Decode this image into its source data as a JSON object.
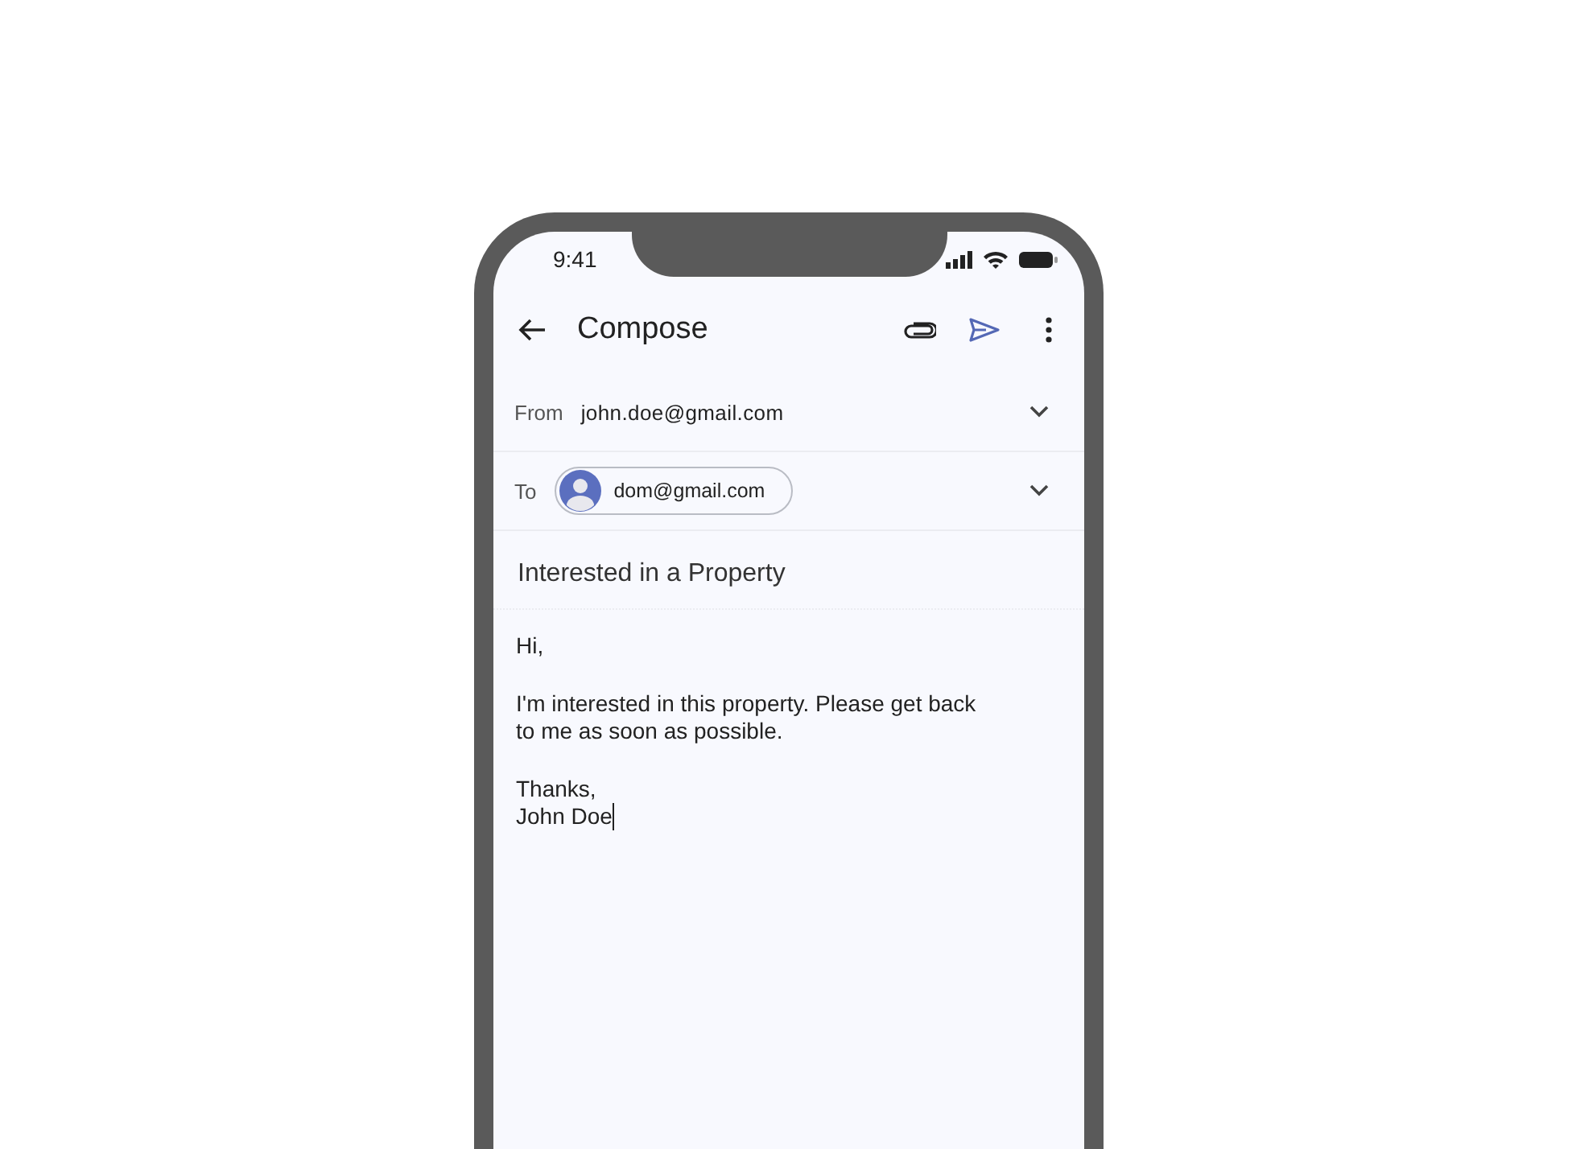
{
  "status_bar": {
    "time": "9:41"
  },
  "app_bar": {
    "title": "Compose"
  },
  "from": {
    "label": "From",
    "value": "john.doe@gmail.com"
  },
  "to": {
    "label": "To",
    "recipients": [
      {
        "address": "dom@gmail.com"
      }
    ]
  },
  "subject": {
    "value": "Interested in a Property"
  },
  "body": {
    "paragraphs": [
      [
        "Hi,"
      ],
      [
        "I'm interested in this property. Please get back",
        "to me as soon as possible."
      ],
      [
        "Thanks,",
        "John Doe"
      ]
    ]
  }
}
